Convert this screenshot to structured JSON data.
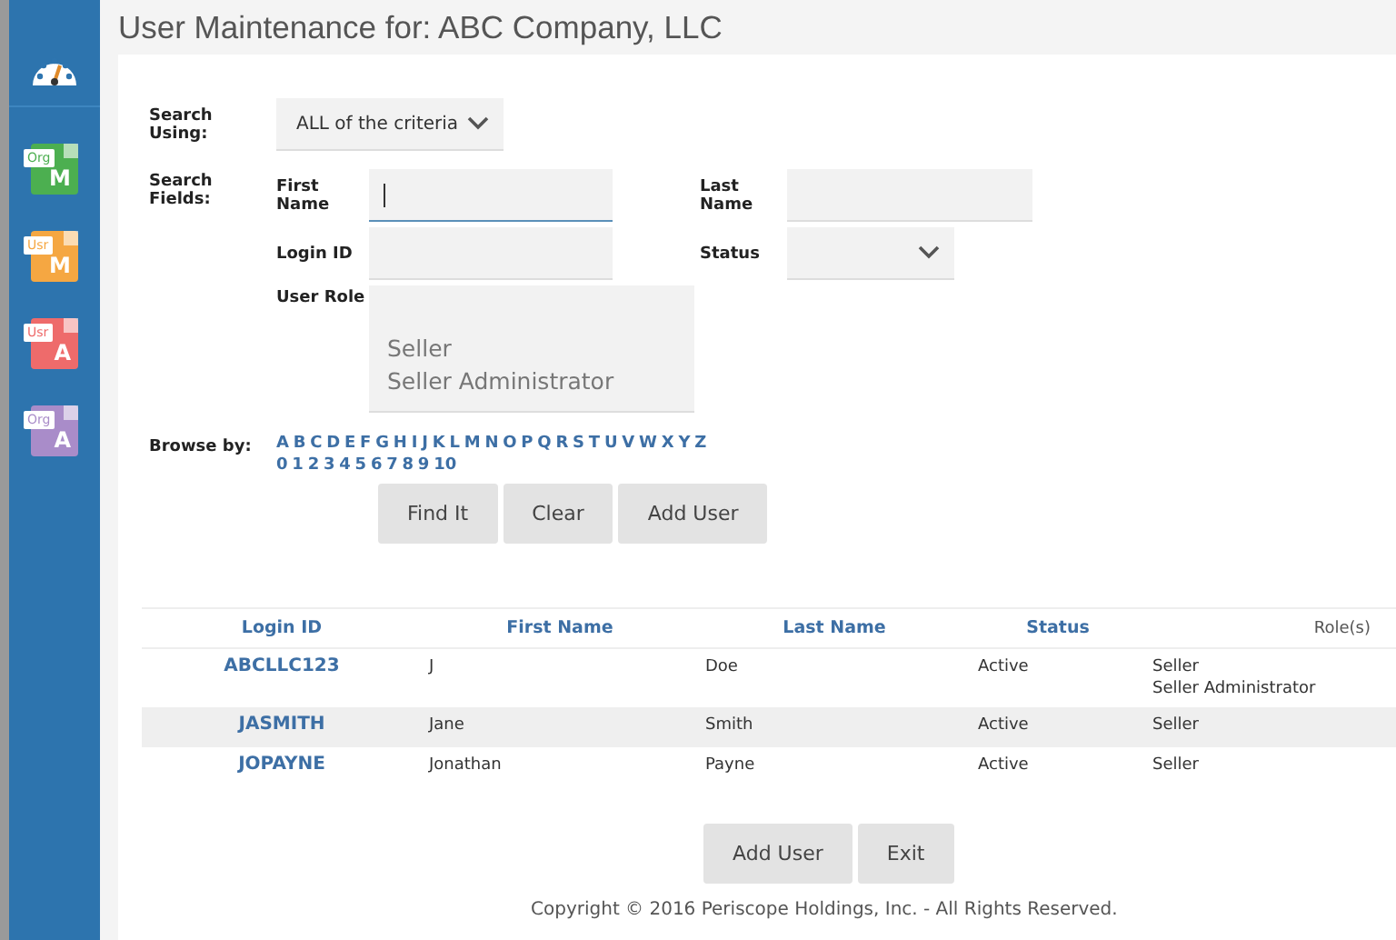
{
  "sidebar": {
    "items": [
      {
        "kind": "gauge"
      },
      {
        "kind": "file",
        "tag": "Org",
        "letter": "M",
        "color": "#4caf50"
      },
      {
        "kind": "file",
        "tag": "Usr",
        "letter": "M",
        "color": "#f5a742"
      },
      {
        "kind": "file",
        "tag": "Usr",
        "letter": "A",
        "color": "#ee6b6b"
      },
      {
        "kind": "file",
        "tag": "Org",
        "letter": "A",
        "color": "#a98cc9"
      }
    ]
  },
  "title": "User Maintenance for: ABC Company, LLC",
  "search_using": {
    "label": "Search Using:",
    "value": "ALL of the criteria"
  },
  "search_fields": {
    "label": "Search Fields:",
    "first_name": {
      "label": "First Name",
      "focused": true
    },
    "last_name": {
      "label": "Last Name"
    },
    "login_id": {
      "label": "Login ID"
    },
    "status": {
      "label": "Status"
    },
    "user_role": {
      "label": "User Role",
      "options": [
        "Seller",
        "Seller Administrator"
      ]
    }
  },
  "browse": {
    "label": "Browse by:",
    "letters": [
      "A",
      "B",
      "C",
      "D",
      "E",
      "F",
      "G",
      "H",
      "I",
      "J",
      "K",
      "L",
      "M",
      "N",
      "O",
      "P",
      "Q",
      "R",
      "S",
      "T",
      "U",
      "V",
      "W",
      "X",
      "Y",
      "Z"
    ],
    "numbers": [
      "0",
      "1",
      "2",
      "3",
      "4",
      "5",
      "6",
      "7",
      "8",
      "9",
      "10"
    ]
  },
  "search_buttons": [
    "Find It",
    "Clear",
    "Add User"
  ],
  "table": {
    "columns": [
      "Login ID",
      "First Name",
      "Last Name",
      "Status",
      "Role(s)"
    ],
    "rows": [
      {
        "login_id": "ABCLLC123",
        "first_name": "J",
        "last_name": "Doe",
        "status": "Active",
        "roles": [
          "Seller",
          "Seller Administrator"
        ]
      },
      {
        "login_id": "JASMITH",
        "first_name": "Jane",
        "last_name": "Smith",
        "status": "Active",
        "roles": [
          "Seller"
        ]
      },
      {
        "login_id": "JOPAYNE",
        "first_name": "Jonathan",
        "last_name": "Payne",
        "status": "Active",
        "roles": [
          "Seller"
        ]
      }
    ]
  },
  "bottom_buttons": [
    "Add User",
    "Exit"
  ],
  "footer": "Copyright © 2016 Periscope Holdings, Inc. - All Rights Reserved."
}
